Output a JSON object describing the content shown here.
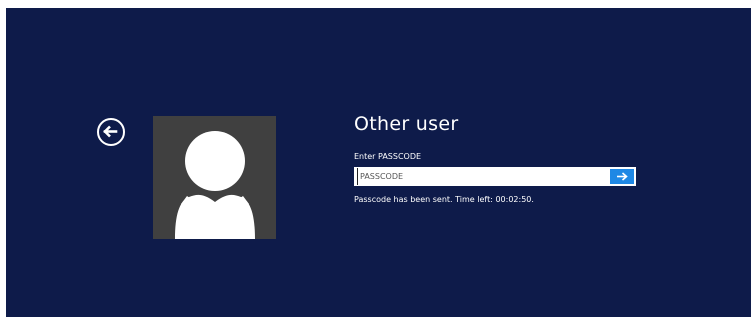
{
  "login": {
    "user_name": "Other user",
    "prompt_label": "Enter PASSCODE",
    "passcode_placeholder": "PASSCODE",
    "passcode_value": "",
    "status_message": "Passcode has been sent. Time left: 00:02:50."
  },
  "icons": {
    "back": "back-arrow-icon",
    "submit": "submit-arrow-icon",
    "avatar": "user-silhouette-icon"
  },
  "colors": {
    "background": "#0e1b4a",
    "avatar_background": "#404040",
    "submit_accent": "#1e88e5",
    "text": "#ffffff"
  }
}
